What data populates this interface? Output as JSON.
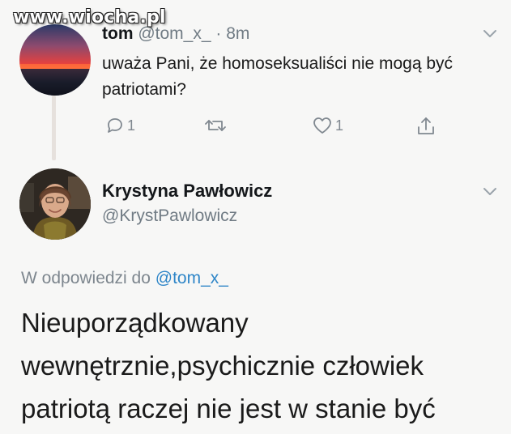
{
  "watermark": {
    "text": "www.wiocha.pl"
  },
  "tweet_parent": {
    "author_name": "tom",
    "author_handle": "@tom_x_",
    "separator": "·",
    "time": "8m",
    "text": "uważa Pani, że homoseksualiści nie mogą być patriotami?",
    "actions": {
      "reply_count": "1",
      "retweet_count": "",
      "like_count": "1"
    }
  },
  "tweet_reply": {
    "author_name": "Krystyna Pawłowicz",
    "author_handle": "@KrystPawlowicz",
    "reply_prefix": "W odpowiedzi do",
    "reply_mention": "@tom_x_",
    "text": "Nieuporządkowany wewnętrznie,psychicznie człowiek patriotą raczej nie jest w stanie być"
  },
  "colors": {
    "background": "#f7f7f6",
    "text": "#1a1a1a",
    "secondary": "#707b84",
    "mention": "#2f86c8",
    "icon": "#808890"
  },
  "icons": [
    "reply-icon",
    "retweet-icon",
    "like-icon",
    "share-icon",
    "chevron-down-icon"
  ]
}
